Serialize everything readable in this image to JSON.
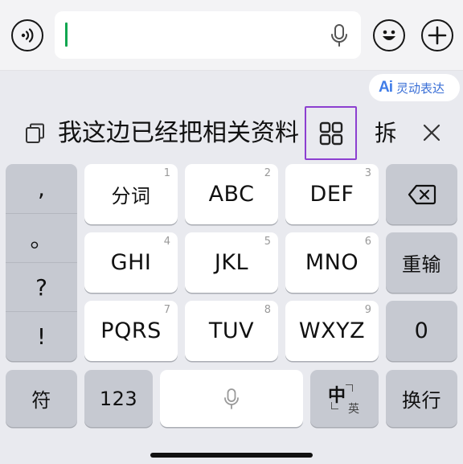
{
  "input_bar": {
    "voice_icon": "voice-wave-icon",
    "field_value": "",
    "mic_icon": "microphone-icon",
    "emoji_icon": "smiley-icon",
    "plus_icon": "plus-icon"
  },
  "ai_chip": {
    "logo": "Ai",
    "label": "灵动表达"
  },
  "candidates": {
    "copy_icon": "copy-icon",
    "text": "我这边已经把相关资料",
    "grid_icon": "grid-icon",
    "split_label": "拆",
    "close_icon": "close-icon"
  },
  "punctuation": [
    ",",
    "。",
    "?",
    "!"
  ],
  "keys": {
    "k1": {
      "label": "分词",
      "num": "1"
    },
    "k2": {
      "label": "ABC",
      "num": "2"
    },
    "k3": {
      "label": "DEF",
      "num": "3"
    },
    "k4": {
      "label": "GHI",
      "num": "4"
    },
    "k5": {
      "label": "JKL",
      "num": "5"
    },
    "k6": {
      "label": "MNO",
      "num": "6"
    },
    "k7": {
      "label": "PQRS",
      "num": "7"
    },
    "k8": {
      "label": "TUV",
      "num": "8"
    },
    "k9": {
      "label": "WXYZ",
      "num": "9"
    },
    "backspace_icon": "backspace-icon",
    "reenter": "重输",
    "zero": "0",
    "symbols": "符",
    "numbers": "123",
    "space_icon": "microphone-icon",
    "lang_main": "中",
    "lang_alt": "英",
    "newline": "换行"
  },
  "colors": {
    "caret": "#11a650",
    "ai_accent": "#3f7ce8",
    "highlight_border": "#8c3fd0",
    "key_light": "#ffffff",
    "key_dark": "#c6c9d1",
    "background": "#e9eaef"
  }
}
